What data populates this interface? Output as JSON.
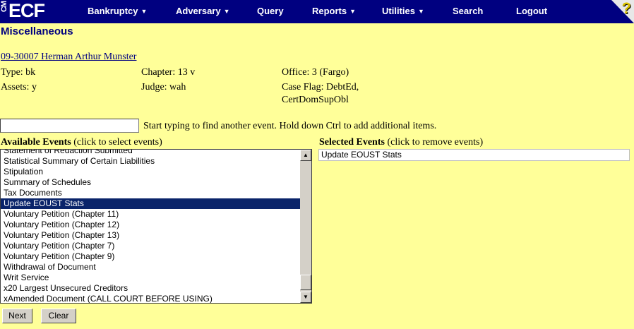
{
  "brand": {
    "prefix": "CM",
    "name": "ECF"
  },
  "nav": [
    {
      "label": "Bankruptcy",
      "has_menu": true
    },
    {
      "label": "Adversary",
      "has_menu": true
    },
    {
      "label": "Query",
      "has_menu": false
    },
    {
      "label": "Reports",
      "has_menu": true
    },
    {
      "label": "Utilities",
      "has_menu": true
    },
    {
      "label": "Search",
      "has_menu": false
    },
    {
      "label": "Logout",
      "has_menu": false
    }
  ],
  "help_icon": "?",
  "page_title": "Miscellaneous",
  "case": {
    "link": "09-30007 Herman Arthur Munster",
    "type": "Type: bk",
    "assets": "Assets: y",
    "chapter": "Chapter: 13 v",
    "judge": "Judge: wah",
    "office": "Office: 3 (Fargo)",
    "case_flag_line1": "Case Flag: DebtEd,",
    "case_flag_line2": "CertDomSupObl"
  },
  "search": {
    "value": "",
    "hint": "Start typing to find another event. Hold down Ctrl to add additional items."
  },
  "available": {
    "heading": "Available Events",
    "subheading": "(click to select events)",
    "items": [
      "Statement of Redaction Submitted",
      "Statistical Summary of Certain Liabilities",
      "Stipulation",
      "Summary of Schedules",
      "Tax Documents",
      "Update EOUST Stats",
      "Voluntary Petition (Chapter 11)",
      "Voluntary Petition (Chapter 12)",
      "Voluntary Petition (Chapter 13)",
      "Voluntary Petition (Chapter 7)",
      "Voluntary Petition (Chapter 9)",
      "Withdrawal of Document",
      "Writ Service",
      "x20 Largest Unsecured Creditors",
      "xAmended Document (CALL COURT BEFORE USING)"
    ],
    "selected_item": "Update EOUST Stats"
  },
  "selected": {
    "heading": "Selected Events",
    "subheading": "(click to remove events)",
    "items": [
      "Update EOUST Stats"
    ]
  },
  "buttons": {
    "next": "Next",
    "clear": "Clear"
  },
  "colors": {
    "nav_bg": "#000080",
    "page_bg": "#ffff99",
    "selection_bg": "#0a246a",
    "link": "#000080"
  }
}
